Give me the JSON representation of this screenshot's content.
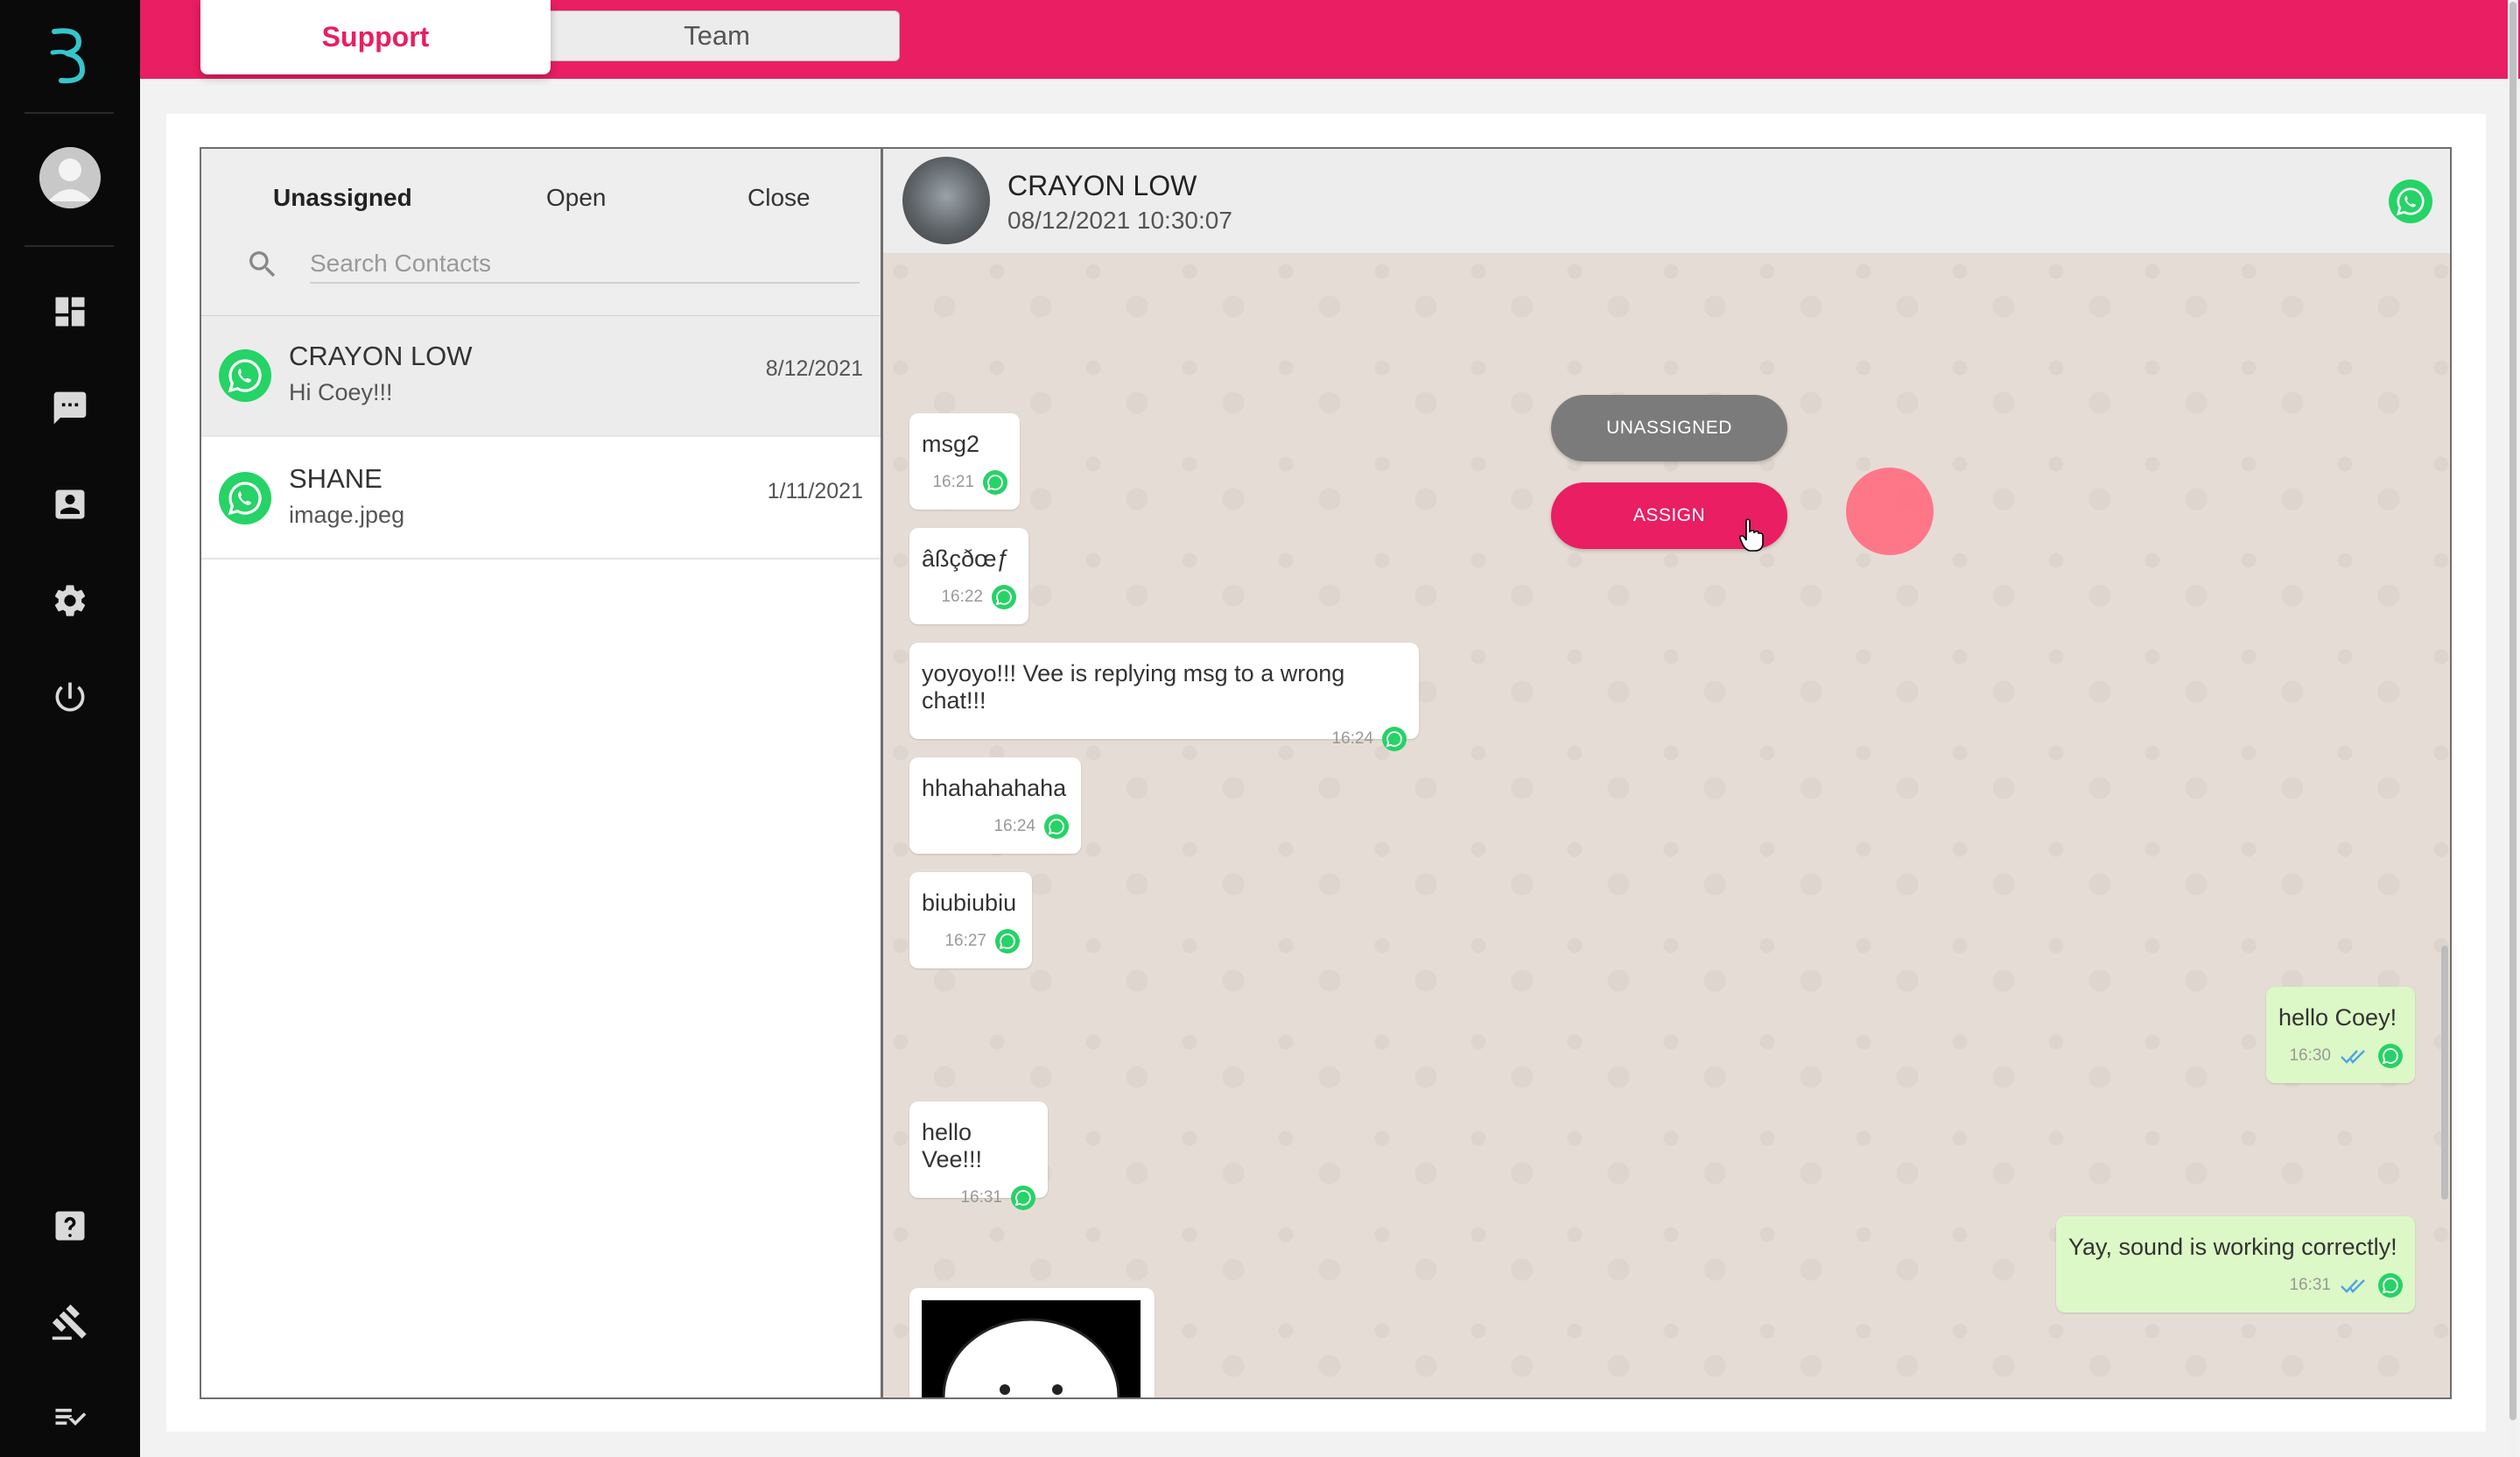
{
  "colors": {
    "brand": "#e91e63",
    "sidebar": "#0a0a0a",
    "whatsapp": "#25d366",
    "outgoing_bubble": "#dcf8c6"
  },
  "top_tabs": {
    "support": "Support",
    "team": "Team"
  },
  "sidebar": {
    "icons": [
      "logo-icon",
      "avatar",
      "dashboard-icon",
      "chat-icon",
      "contacts-icon",
      "settings-icon",
      "power-icon",
      "help-icon",
      "gavel-icon",
      "checklist-icon"
    ]
  },
  "contacts": {
    "filters": {
      "unassigned": "Unassigned",
      "open": "Open",
      "close": "Close"
    },
    "search": {
      "placeholder": "Search Contacts"
    },
    "items": [
      {
        "name": "CRAYON LOW",
        "preview": "Hi Coey!!!",
        "date": "8/12/2021"
      },
      {
        "name": "SHANE",
        "preview": "image.jpeg",
        "date": "1/11/2021"
      }
    ]
  },
  "chat": {
    "header": {
      "name": "CRAYON LOW",
      "datetime": "08/12/2021 10:30:07"
    },
    "actions": {
      "unassigned": "UNASSIGNED",
      "assign": "ASSIGN"
    },
    "messages": [
      {
        "text": "msg2",
        "time": "16:21",
        "dir": "in"
      },
      {
        "text": "âßçðœƒ",
        "time": "16:22",
        "dir": "in"
      },
      {
        "text": "yoyoyo!!! Vee is replying msg to a wrong chat!!!",
        "time": "16:24",
        "dir": "in"
      },
      {
        "text": "hhahahahaha",
        "time": "16:24",
        "dir": "in"
      },
      {
        "text": "biubiubiu",
        "time": "16:27",
        "dir": "in"
      },
      {
        "text": "hello Coey!",
        "time": "16:30",
        "dir": "out"
      },
      {
        "text": "hello Vee!!!",
        "time": "16:31",
        "dir": "in"
      },
      {
        "text": "Yay, sound is working correctly!",
        "time": "16:31",
        "dir": "out"
      }
    ]
  }
}
